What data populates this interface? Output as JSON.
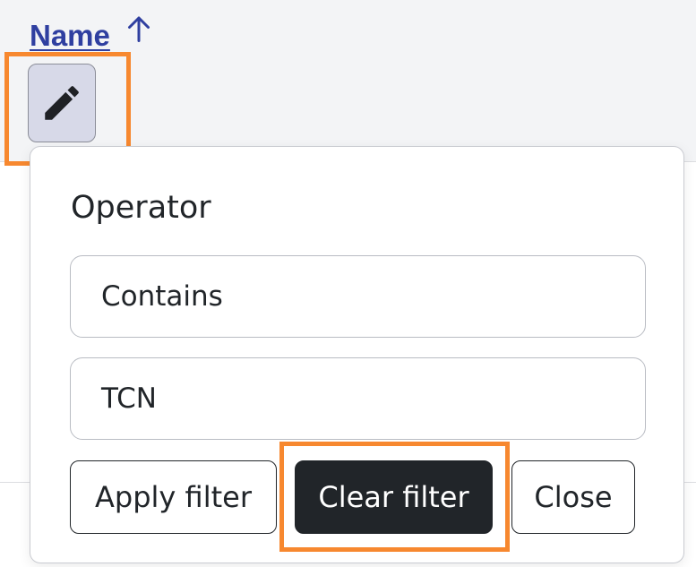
{
  "table_header": {
    "column_name": "Name",
    "sort_icon": "arrow-up-icon",
    "edit_icon": "pencil-icon"
  },
  "filter_popover": {
    "operator_label": "Operator",
    "operator_value": "Contains",
    "filter_value": "TCN",
    "buttons": {
      "apply": "Apply filter",
      "clear": "Clear filter",
      "close": "Close"
    }
  },
  "colors": {
    "link": "#2f3fa0",
    "highlight": "#f7882f",
    "dark_button": "#212529"
  }
}
